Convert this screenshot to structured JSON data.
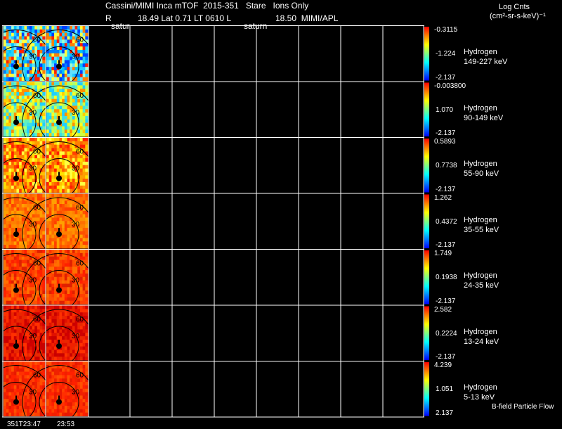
{
  "header": {
    "line1": "Cassini/MIMI Inca mTOF  2015-351   Stare   Ions Only",
    "line2_prefix": "R",
    "line2_main": "18.49 Lat 0.71 LT 0610 L",
    "line2_value": "18.50  MIMI/APL",
    "saturn_label_1": "satur",
    "saturn_label_2": "saturn",
    "units_line1": "Log Cnts",
    "units_line2": "(cm²-sr-s-keV)⁻¹"
  },
  "rows": [
    {
      "species": "Hydrogen",
      "energy": "149-227 keV",
      "cb_max": "-0.3115",
      "cb_mid": "-1.224",
      "cb_min": "-2.137",
      "palette": "blue"
    },
    {
      "species": "Hydrogen",
      "energy": "90-149 keV",
      "cb_max": "-0.003800",
      "cb_mid": "1.070",
      "cb_min": "-2.137",
      "palette": "cyan"
    },
    {
      "species": "Hydrogen",
      "energy": "55-90 keV",
      "cb_max": "0.5893",
      "cb_mid": "0.7738",
      "cb_min": "-2.137",
      "palette": "orange"
    },
    {
      "species": "Hydrogen",
      "energy": "35-55 keV",
      "cb_max": "1.262",
      "cb_mid": "0.4372",
      "cb_min": "-2.137",
      "palette": "orange2"
    },
    {
      "species": "Hydrogen",
      "energy": "24-35 keV",
      "cb_max": "1.749",
      "cb_mid": "0.1938",
      "cb_min": "-2.137",
      "palette": "red"
    },
    {
      "species": "Hydrogen",
      "energy": "13-24 keV",
      "cb_max": "2.582",
      "cb_mid": "0.2224",
      "cb_min": "-2.137",
      "palette": "darkred"
    },
    {
      "species": "Hydrogen",
      "energy": "5-13 keV",
      "cb_max": "4.239",
      "cb_mid": "1.051",
      "cb_min": "2.137",
      "palette": "red2"
    }
  ],
  "contour_labels": [
    "60",
    "30"
  ],
  "footer": {
    "time_1": "351T23:47",
    "time_2": "23:53",
    "bfield_label": "B-field Particle Flow"
  }
}
